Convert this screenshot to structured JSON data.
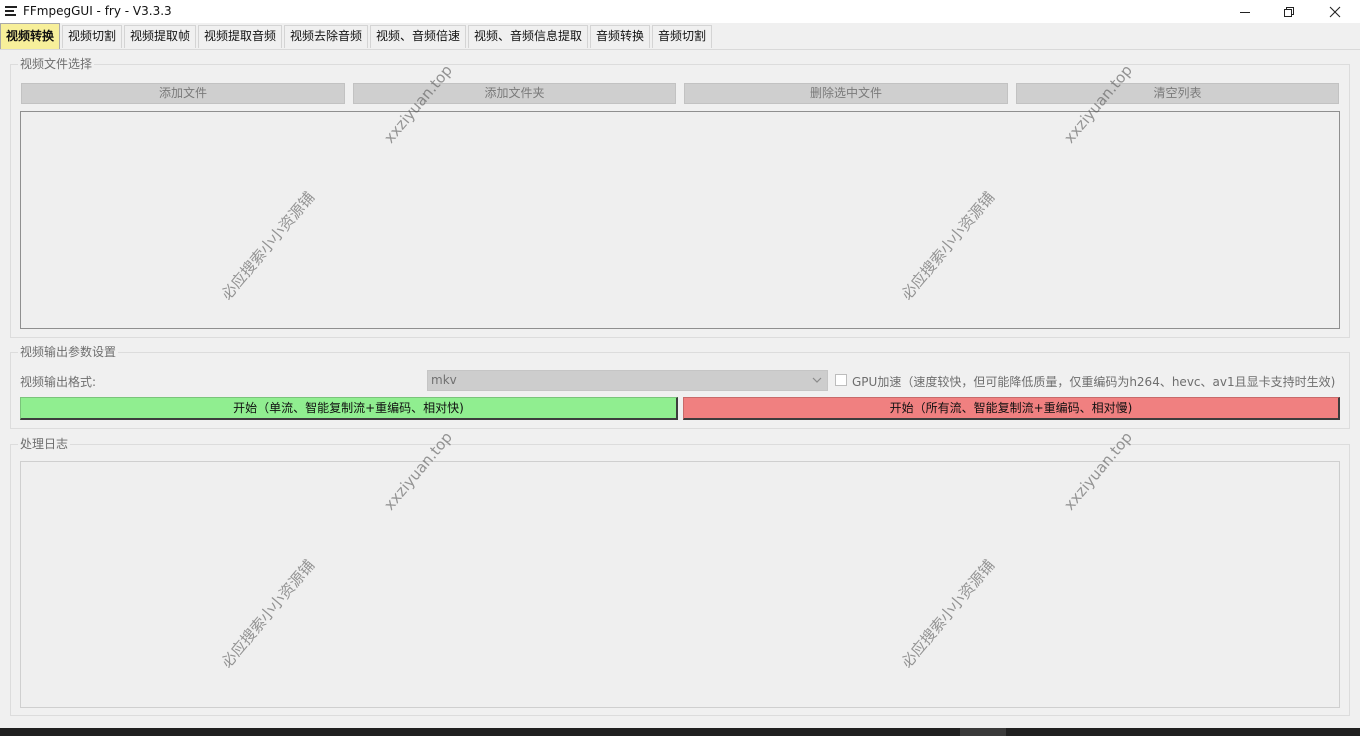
{
  "window": {
    "title": "FFmpegGUI - fry - V3.3.3",
    "icons": {
      "app": "hamburger-menu-icon",
      "minimize": "minimize-icon",
      "maximize": "restore-icon",
      "close": "close-icon"
    }
  },
  "tabs": [
    {
      "label": "视频转换",
      "active": true
    },
    {
      "label": "视频切割"
    },
    {
      "label": "视频提取帧"
    },
    {
      "label": "视频提取音频"
    },
    {
      "label": "视频去除音频"
    },
    {
      "label": "视频、音频倍速"
    },
    {
      "label": "视频、音频信息提取"
    },
    {
      "label": "音频转换"
    },
    {
      "label": "音频切割"
    }
  ],
  "file_section": {
    "title": "视频文件选择",
    "buttons": {
      "add_file": "添加文件",
      "add_folder": "添加文件夹",
      "delete_selected": "删除选中文件",
      "clear_list": "清空列表"
    }
  },
  "output_section": {
    "title": "视频输出参数设置",
    "format_label": "视频输出格式:",
    "format_value": "mkv",
    "gpu_checked": false,
    "gpu_label": "GPU加速（速度较快，但可能降低质量，仅重编码为h264、hevc、av1且显卡支持时生效)",
    "start_single": "开始（单流、智能复制流+重编码、相对快)",
    "start_all": "开始（所有流、智能复制流+重编码、相对慢)"
  },
  "log_section": {
    "title": "处理日志"
  },
  "watermarks": {
    "site": "xxziyuan.top",
    "name": "必应搜索小小资源铺"
  },
  "colors": {
    "active_tab": "#f7ef9a",
    "start_single_bg": "#90ee90",
    "start_all_bg": "#f08080"
  }
}
